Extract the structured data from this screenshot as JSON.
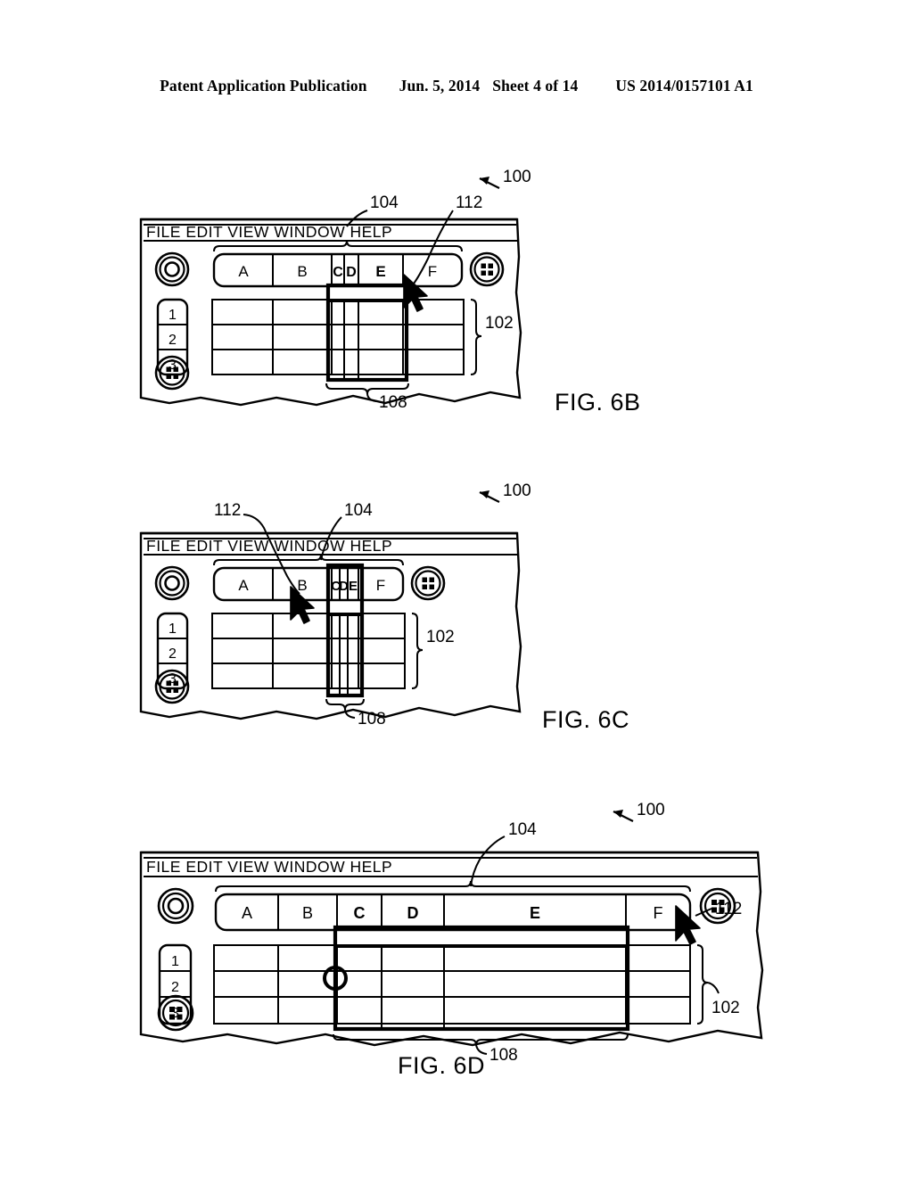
{
  "publication_header": {
    "left": "Patent Application Publication",
    "date": "Jun. 5, 2014",
    "sheet": "Sheet 4 of 14",
    "number": "US 2014/0157101 A1"
  },
  "menu_bar": {
    "items": [
      "FILE",
      "EDIT",
      "VIEW",
      "WINDOW",
      "HELP"
    ],
    "text": "FILE  EDIT  VIEW  WINDOW  HELP"
  },
  "grid": {
    "column_headers": [
      "A",
      "B",
      "C",
      "D",
      "E",
      "F"
    ],
    "row_headers": [
      "1",
      "2",
      "3"
    ]
  },
  "reference_numerals": {
    "device": "100",
    "grid_region": "102",
    "column_header_bar": "104",
    "selection_box": "108",
    "cursor": "112"
  },
  "icons": {
    "top_left": "target-circle-icon",
    "top_right": "grid-four-squares-icon",
    "bottom_left": "grid-four-squares-icon",
    "cursor": "mouse-pointer-icon",
    "drag_handle": "circle-drag-handle-icon"
  },
  "figures": [
    {
      "id": "fig6b",
      "caption": "FIG. 6B",
      "state": "columns C D E partially collapsed, cursor at right edge of selection",
      "visible_columns": [
        "A",
        "B",
        "C",
        "D",
        "E",
        "F"
      ],
      "selected_columns": [
        "C",
        "D",
        "E"
      ],
      "callouts": [
        "100",
        "104",
        "112",
        "102",
        "108"
      ]
    },
    {
      "id": "fig6c",
      "caption": "FIG. 6C",
      "state": "columns C D E fully collapsed, cursor moved left",
      "visible_columns": [
        "A",
        "B",
        "C",
        "D",
        "E",
        "F"
      ],
      "selected_columns": [
        "C",
        "D",
        "E"
      ],
      "callouts": [
        "112",
        "104",
        "100",
        "102",
        "108"
      ]
    },
    {
      "id": "fig6d",
      "caption": "FIG. 6D",
      "state": "columns C D E expanded, column E widest, drag handle shown on left edge",
      "visible_columns": [
        "A",
        "B",
        "C",
        "D",
        "E",
        "F"
      ],
      "selected_columns": [
        "C",
        "D",
        "E"
      ],
      "callouts": [
        "100",
        "104",
        "112",
        "102",
        "108"
      ]
    }
  ],
  "colors": {
    "ink": "#000000",
    "paper": "#ffffff"
  }
}
